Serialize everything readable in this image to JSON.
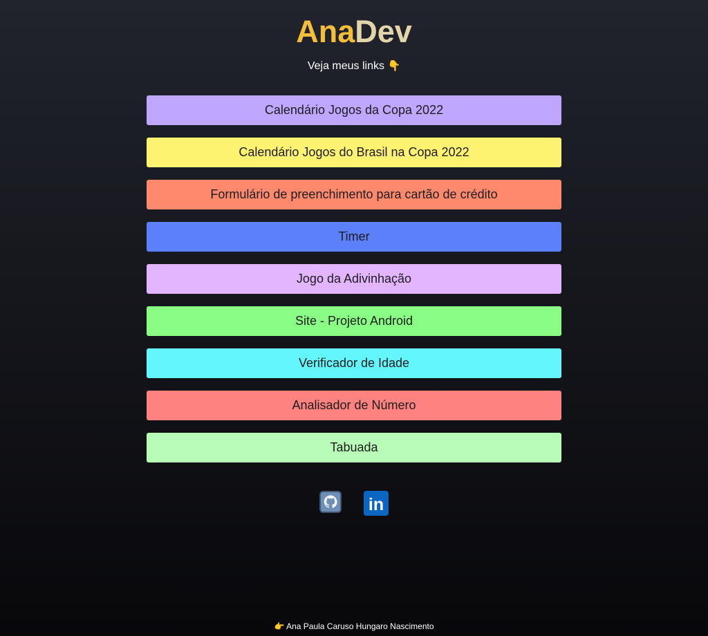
{
  "header": {
    "brand_first": "Ana",
    "brand_second": "Dev",
    "subtitle": "Veja meus links",
    "subtitle_emoji": "👇"
  },
  "links": [
    {
      "label": "Calendário Jogos da Copa 2022",
      "color": "#bfa6ff"
    },
    {
      "label": "Calendário Jogos do Brasil na Copa 2022",
      "color": "#fef271"
    },
    {
      "label": "Formulário de preenchimento para cartão de crédito",
      "color": "#fe896c"
    },
    {
      "label": "Timer",
      "color": "#5b80f9"
    },
    {
      "label": "Jogo da Adivinhação",
      "color": "#e4b5ff"
    },
    {
      "label": "Site - Projeto Android",
      "color": "#89fd84"
    },
    {
      "label": "Verificador de Idade",
      "color": "#63f7fd"
    },
    {
      "label": "Analisador de Número",
      "color": "#fe827f"
    },
    {
      "label": "Tabuada",
      "color": "#b8fcb8"
    }
  ],
  "social": {
    "github_icon": "github-icon",
    "linkedin_icon": "linkedin-icon",
    "linkedin_text": "in"
  },
  "footer": {
    "emoji": "👉",
    "text": "Ana Paula Caruso Hungaro Nascimento"
  },
  "colors": {
    "brand_accent": "#f4be3a",
    "brand_secondary": "#e2d5aa",
    "linkedin_blue": "#0a66c2",
    "github_bg": "#6f8fb6"
  }
}
